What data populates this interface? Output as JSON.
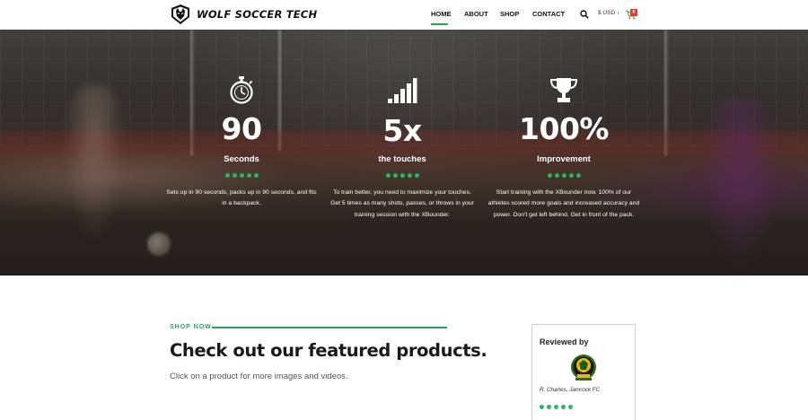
{
  "header": {
    "logo_text": "WOLF SOCCER TECH",
    "nav": [
      {
        "label": "HOME",
        "active": true
      },
      {
        "label": "ABOUT",
        "active": false
      },
      {
        "label": "SHOP",
        "active": false
      },
      {
        "label": "CONTACT",
        "active": false
      }
    ],
    "search_icon": "search-icon",
    "currency_label": "$ USD",
    "cart_icon": "cart-icon",
    "cart_count": "0"
  },
  "hero": {
    "stats": [
      {
        "icon": "stopwatch-icon",
        "value": "90",
        "label": "Seconds",
        "description": "Sets up in 90 seconds, packs up in 90 seconds, and fits in a backpack."
      },
      {
        "icon": "signal-bars-icon",
        "value": "5x",
        "label": "the touches",
        "description": "To train better, you need to maximize your touches. Get 5 times as many shots, passes, or throws in your training session with the XBounder."
      },
      {
        "icon": "trophy-icon",
        "value": "100%",
        "label": "Improvement",
        "description": "Start training with the XBounder now. 100% of our athletes scored more goals and increased accuracy and power. Don't get left behind. Get in front of the pack."
      }
    ]
  },
  "shop": {
    "eyebrow": "SHOP NOW",
    "heading": "Check out our featured products.",
    "subtext": "Click on a product for more images and videos."
  },
  "review": {
    "title": "Reviewed by",
    "reviewer": "R. Charles, Jamrock FC",
    "logo_icon": "club-crest-icon"
  },
  "colors": {
    "accent": "#27a35a",
    "cart_badge": "#e53935"
  }
}
